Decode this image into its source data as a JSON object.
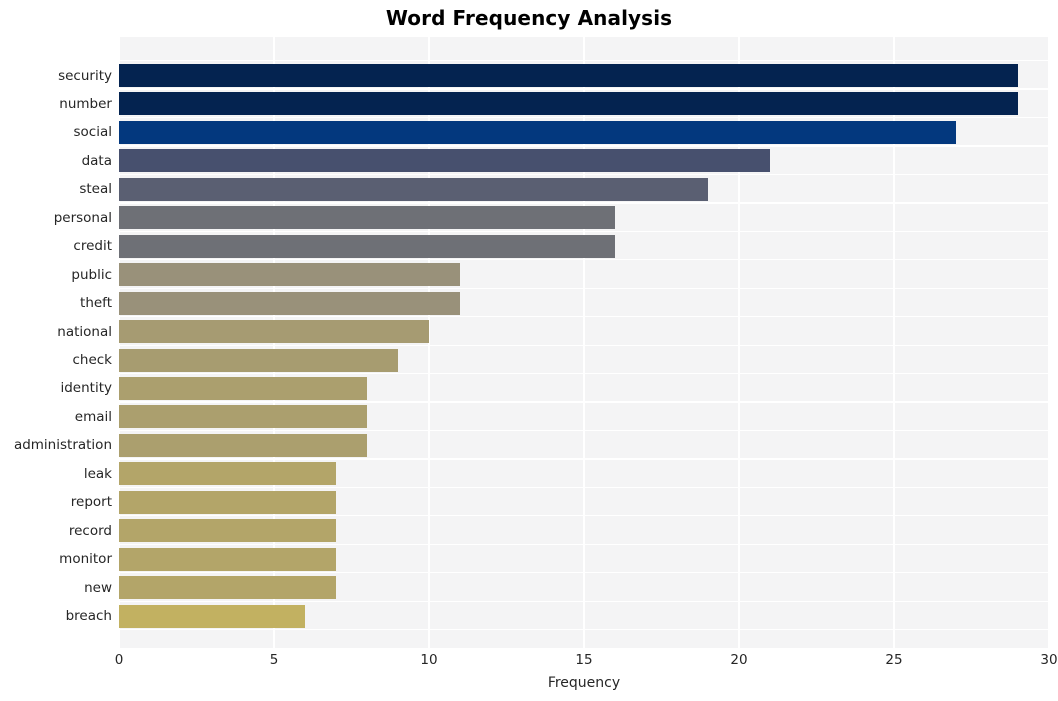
{
  "chart_data": {
    "type": "bar",
    "orientation": "horizontal",
    "title": "Word Frequency Analysis",
    "xlabel": "Frequency",
    "ylabel": "",
    "xlim": [
      0,
      30
    ],
    "xticks": [
      0,
      5,
      10,
      15,
      20,
      25,
      30
    ],
    "xtick_labels": [
      "0",
      "5",
      "10",
      "15",
      "20",
      "25",
      "30"
    ],
    "grid": true,
    "grid_color": "#ffffff",
    "plot_background": "#f4f4f5",
    "legend": null,
    "categories": [
      "security",
      "number",
      "social",
      "data",
      "steal",
      "personal",
      "credit",
      "public",
      "theft",
      "national",
      "check",
      "identity",
      "email",
      "administration",
      "leak",
      "report",
      "record",
      "monitor",
      "new",
      "breach"
    ],
    "values": [
      29,
      29,
      27,
      21,
      19,
      16,
      16,
      11,
      11,
      10,
      9,
      8,
      8,
      8,
      7,
      7,
      7,
      7,
      7,
      6
    ],
    "bar_colors": [
      "#042350",
      "#042350",
      "#03387e",
      "#47506e",
      "#5a5f72",
      "#6e7076",
      "#6e7076",
      "#99917a",
      "#99917a",
      "#a69b72",
      "#a79c70",
      "#ab9f6e",
      "#ab9f6e",
      "#ab9f6e",
      "#b3a569",
      "#b3a569",
      "#b3a569",
      "#b3a569",
      "#b3a569",
      "#c2b161"
    ]
  }
}
